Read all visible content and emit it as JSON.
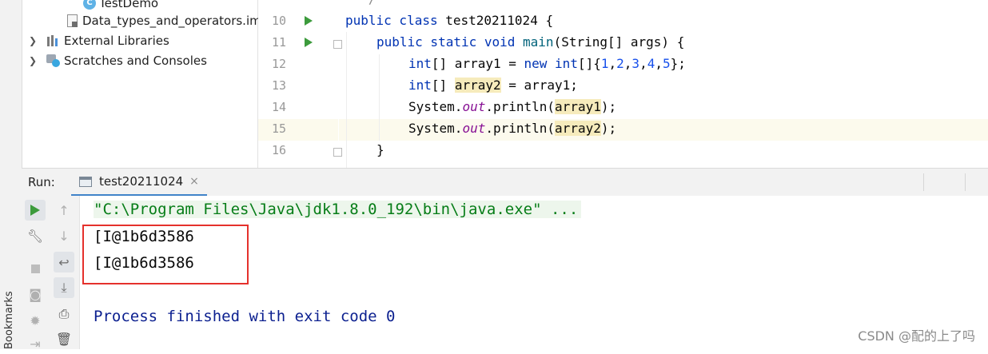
{
  "project_tree": {
    "items": [
      {
        "label": "TestDemo",
        "icon": "class-icon"
      },
      {
        "label": "Data_types_and_operators.iml",
        "icon": "iml-file-icon"
      },
      {
        "label": "External Libraries",
        "icon": "libraries-icon"
      },
      {
        "label": "Scratches and Consoles",
        "icon": "scratches-icon"
      }
    ]
  },
  "editor": {
    "line_numbers": [
      "10",
      "11",
      "12",
      "13",
      "14",
      "15",
      "16"
    ],
    "lines": {
      "l10": {
        "kw1": "public class",
        "rest": " test20211024 {"
      },
      "l11": {
        "kw1": "public static void",
        "name": " main",
        "rest": "(String[] args) {"
      },
      "l12": {
        "kw1": "int",
        "p1": "[] array1 = ",
        "kw2": "new",
        "p2": " ",
        "kw3": "int",
        "p3": "[]{",
        "n1": "1",
        "c1": ",",
        "n2": "2",
        "c2": ",",
        "n3": "3",
        "c3": ",",
        "n4": "4",
        "c4": ",",
        "n5": "5",
        "p4": "};"
      },
      "l13": {
        "kw1": "int",
        "p1": "[] ",
        "var": "array2",
        "p2": " = array1;"
      },
      "l14": {
        "p1": "System.",
        "field": "out",
        "p2": ".println(",
        "var": "array1",
        "p3": ");"
      },
      "l15": {
        "p1": "System.",
        "field": "out",
        "p2": ".println(",
        "var": "array2",
        "p3": ");"
      },
      "l16": {
        "brace": "}"
      }
    }
  },
  "run": {
    "label": "Run:",
    "tab_name": "test20211024",
    "tab_close": "×",
    "console": {
      "command": "\"C:\\Program Files\\Java\\jdk1.8.0_192\\bin\\java.exe\" ...",
      "output": [
        "[I@1b6d3586",
        "[I@1b6d3586"
      ],
      "exit_message": "Process finished with exit code 0"
    },
    "bookmarks_label": "Bookmarks"
  },
  "watermark": "CSDN @配的上了吗",
  "colors": {
    "keyword": "#0033b3",
    "number": "#1750eb",
    "field": "#871094",
    "var_highlight": "#f6ebbc",
    "run_green": "#3c9b3c",
    "annotation_red": "#e5312c",
    "exit_text": "#0b1f8f",
    "command_text": "#067d17"
  }
}
